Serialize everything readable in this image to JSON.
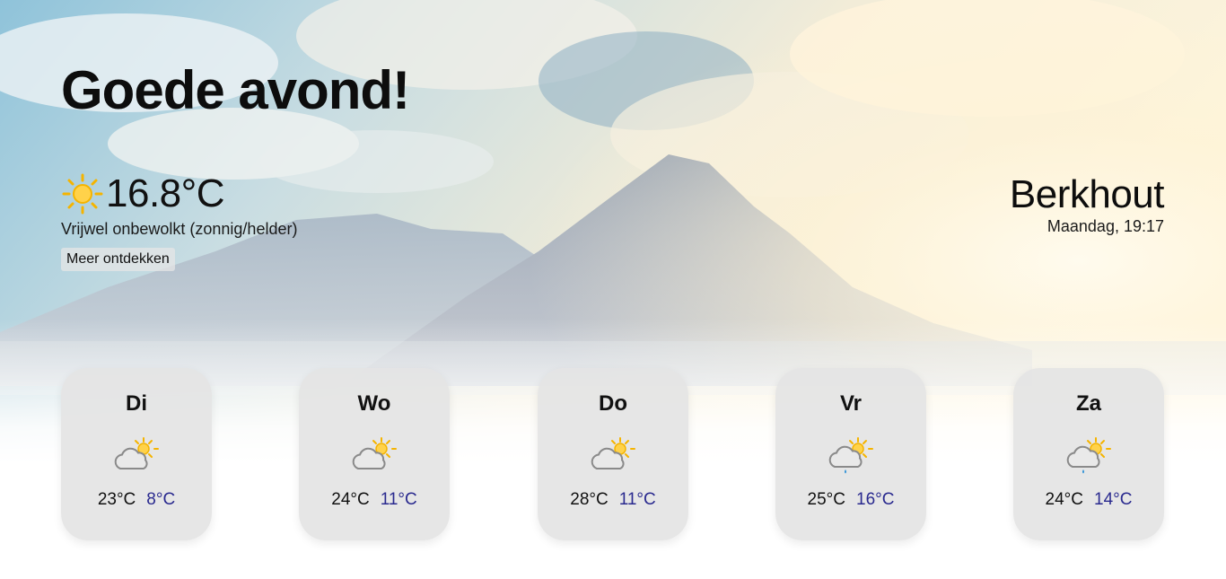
{
  "greeting": "Goede avond!",
  "current": {
    "icon": "sun-icon",
    "temperature": "16.8°C",
    "description": "Vrijwel onbewolkt (zonnig/helder)",
    "discover_label": "Meer ontdekken"
  },
  "location": {
    "city": "Berkhout",
    "datetime": "Maandag, 19:17"
  },
  "forecast": [
    {
      "day": "Di",
      "icon": "partly-cloudy-icon",
      "max": "23°C",
      "min": "8°C"
    },
    {
      "day": "Wo",
      "icon": "partly-cloudy-icon",
      "max": "24°C",
      "min": "11°C"
    },
    {
      "day": "Do",
      "icon": "partly-cloudy-icon",
      "max": "28°C",
      "min": "11°C"
    },
    {
      "day": "Vr",
      "icon": "partly-cloudy-rain-icon",
      "max": "25°C",
      "min": "16°C"
    },
    {
      "day": "Za",
      "icon": "partly-cloudy-rain-icon",
      "max": "24°C",
      "min": "14°C"
    }
  ],
  "colors": {
    "min_temp": "#2a2a8f",
    "sun": "#f5b400",
    "card": "#e4e4e4"
  }
}
